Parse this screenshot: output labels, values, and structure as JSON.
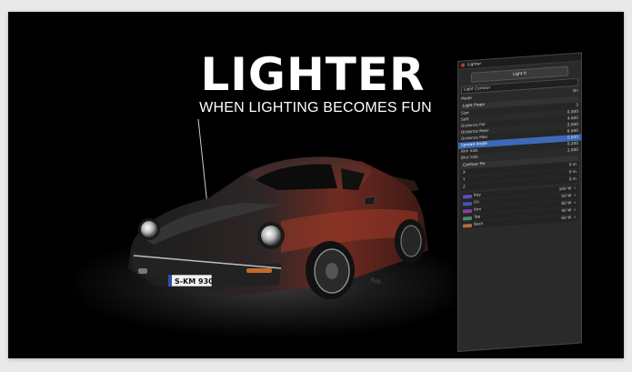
{
  "hero": {
    "title": "LIGHTER",
    "subtitle": "WHEN LIGHTING BECOMES FUN",
    "license_plate": "S-KM 930"
  },
  "panel": {
    "title": "Lighter",
    "main_button": "Light It",
    "select_value": "Light Contour",
    "mode_label": "Mode",
    "mode_value": "On",
    "section_label": "Light Props",
    "props": [
      {
        "label": "Size",
        "value": "3"
      },
      {
        "label": "Soft",
        "value": "0.300"
      },
      {
        "label": "Distance Far",
        "value": "4.000"
      },
      {
        "label": "Distance Near",
        "value": "2.000"
      },
      {
        "label": "Distance Max",
        "value": "6.000"
      },
      {
        "label": "Spread Angle",
        "value": "0.600"
      },
      {
        "label": "Rim Size",
        "value": "0.200"
      },
      {
        "label": "Blur Size",
        "value": "1.000"
      }
    ],
    "contour_label": "Contour Fix",
    "axis_rows": [
      {
        "label": "X",
        "value": "0 m"
      },
      {
        "label": "Y",
        "value": "0 m"
      },
      {
        "label": "Z",
        "value": "0 m"
      }
    ],
    "lights": [
      {
        "name": "Key",
        "color": "#5a4fb8",
        "value": "100 W"
      },
      {
        "name": "Fill",
        "color": "#3a5bb0",
        "value": "50 W"
      },
      {
        "name": "Rim",
        "color": "#8a3fa8",
        "value": "80 W"
      },
      {
        "name": "Top",
        "color": "#4a8a6a",
        "value": "40 W"
      },
      {
        "name": "Back",
        "color": "#b56a3a",
        "value": "60 W"
      }
    ]
  }
}
